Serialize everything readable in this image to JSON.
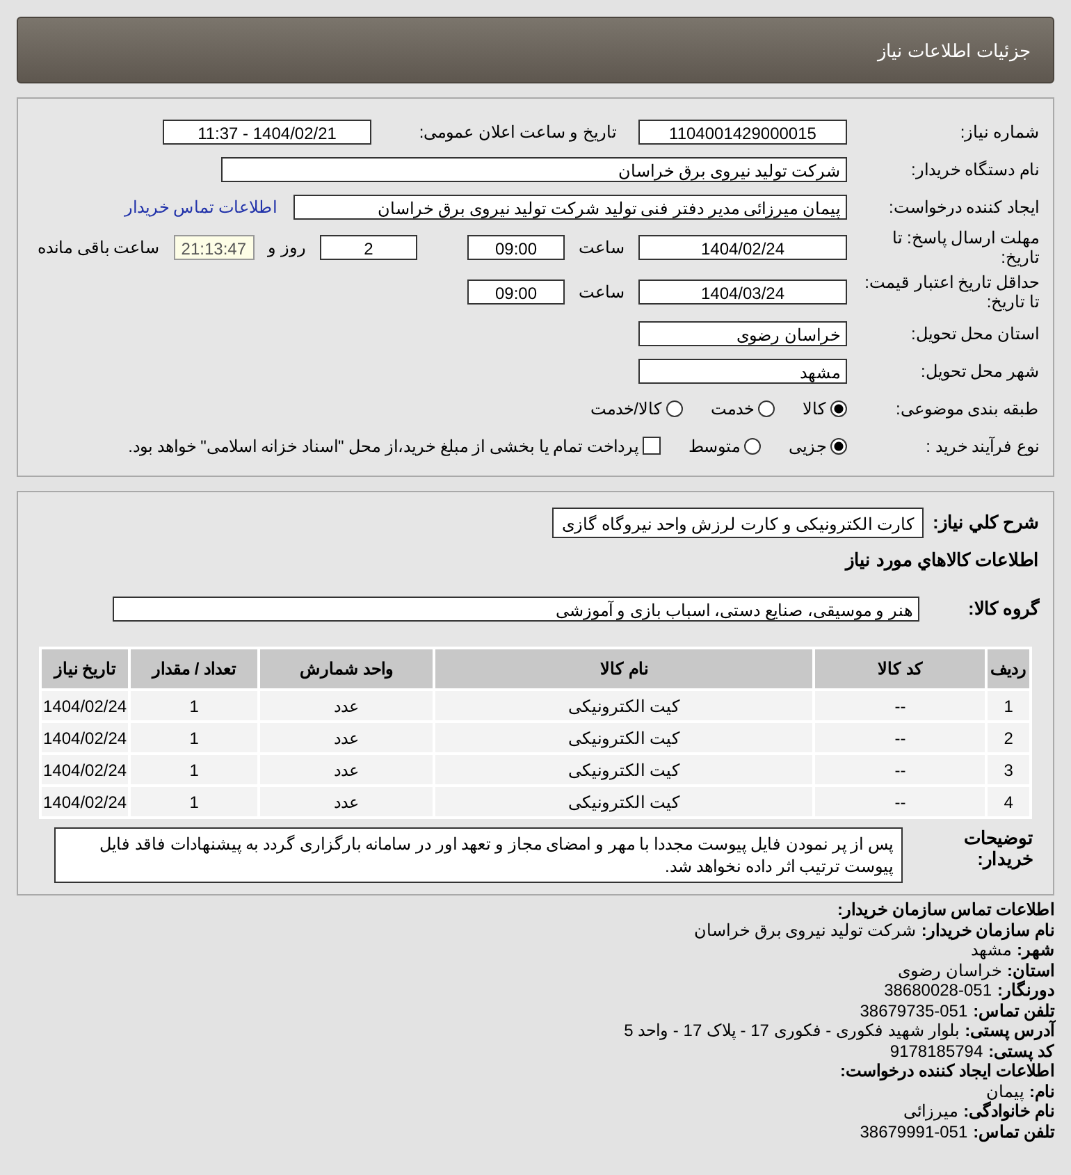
{
  "header": {
    "title": "جزئیات اطلاعات نیاز"
  },
  "details": {
    "need_number": {
      "label": "شماره نیاز:",
      "value": "1104001429000015"
    },
    "announce": {
      "label": "تاریخ و ساعت اعلان عمومی:",
      "value": "1404/02/21 - 11:37"
    },
    "buyer_org": {
      "label": "نام دستگاه خریدار:",
      "value": "شرکت تولید نیروی برق خراسان"
    },
    "creator": {
      "label": "ایجاد کننده درخواست:",
      "value": "پیمان میرزائی مدیر دفتر فنی تولید شرکت تولید نیروی برق خراسان",
      "link": "اطلاعات تماس خریدار"
    },
    "deadline": {
      "label": "مهلت ارسال پاسخ: تا تاریخ:",
      "date": "1404/02/24",
      "time_label": "ساعت",
      "time": "09:00",
      "days": "2",
      "days_label": "روز و",
      "remaining": "21:13:47",
      "remaining_label": "ساعت باقی مانده"
    },
    "validity": {
      "label": "حداقل تاریخ اعتبار قیمت: تا تاریخ:",
      "date": "1404/03/24",
      "time_label": "ساعت",
      "time": "09:00"
    },
    "province": {
      "label": "استان محل تحویل:",
      "value": "خراسان رضوی"
    },
    "city": {
      "label": "شهر محل تحویل:",
      "value": "مشهد"
    },
    "category": {
      "label": "طبقه بندی موضوعی:",
      "options": [
        {
          "label": "کالا",
          "selected": true
        },
        {
          "label": "خدمت",
          "selected": false
        },
        {
          "label": "کالا/خدمت",
          "selected": false
        }
      ]
    },
    "process": {
      "label": "نوع فرآیند خرید :",
      "options": [
        {
          "label": "جزیی",
          "selected": true
        },
        {
          "label": "متوسط",
          "selected": false
        }
      ],
      "payment": {
        "checked": false,
        "label": "پرداخت تمام یا بخشی از مبلغ خرید،از محل \"اسناد خزانه اسلامی\" خواهد بود."
      }
    }
  },
  "summary": {
    "label": "شرح کلي نياز:",
    "value": "کارت الکترونیکی و کارت لرزش واحد نیروگاه گازی"
  },
  "goods_title": "اطلاعات کالاهاي مورد نياز",
  "goods_group": {
    "label": "گروه کالا:",
    "value": "هنر و موسیقی، صنایع دستی، اسباب بازی و آموزشی"
  },
  "table": {
    "columns": [
      "ردیف",
      "کد کالا",
      "نام کالا",
      "واحد شمارش",
      "تعداد / مقدار",
      "تاریخ نیاز"
    ],
    "rows": [
      [
        "1",
        "--",
        "کیت الکترونیکی",
        "عدد",
        "1",
        "1404/02/24"
      ],
      [
        "2",
        "--",
        "کیت الکترونیکی",
        "عدد",
        "1",
        "1404/02/24"
      ],
      [
        "3",
        "--",
        "کیت الکترونیکی",
        "عدد",
        "1",
        "1404/02/24"
      ],
      [
        "4",
        "--",
        "کیت الکترونیکی",
        "عدد",
        "1",
        "1404/02/24"
      ]
    ]
  },
  "buyer_notes": {
    "label": "توضیحات خریدار:",
    "value": "پس از پر نمودن فایل پیوست مجددا با مهر و امضای مجاز و تعهد اور در سامانه بارگزاری گردد به پیشنهادات فاقد فایل پیوست ترتیب اثر داده نخواهد شد."
  },
  "contact": [
    {
      "kind": "heading",
      "label": "اطلاعات تماس سازمان خریدار:"
    },
    {
      "kind": "field",
      "label": "نام سازمان خریدار:",
      "value": "شرکت تولید نیروی برق خراسان"
    },
    {
      "kind": "field",
      "label": "شهر:",
      "value": "مشهد"
    },
    {
      "kind": "field",
      "label": "استان:",
      "value": "خراسان رضوی"
    },
    {
      "kind": "field",
      "label": "دورنگار:",
      "value": "051-38680028"
    },
    {
      "kind": "field",
      "label": "تلفن تماس:",
      "value": "051-38679735"
    },
    {
      "kind": "field",
      "label": "آدرس پستی:",
      "value": "بلوار شهید فکوری - فکوری 17 - پلاک 17 - واحد 5"
    },
    {
      "kind": "field",
      "label": "کد پستی:",
      "value": "9178185794"
    },
    {
      "kind": "heading",
      "label": "اطلاعات ایجاد کننده درخواست:"
    },
    {
      "kind": "field",
      "label": "نام:",
      "value": "پیمان"
    },
    {
      "kind": "field",
      "label": "نام خانوادگی:",
      "value": "میرزائی"
    },
    {
      "kind": "field",
      "label": "تلفن تماس:",
      "value": "051-38679991"
    }
  ]
}
